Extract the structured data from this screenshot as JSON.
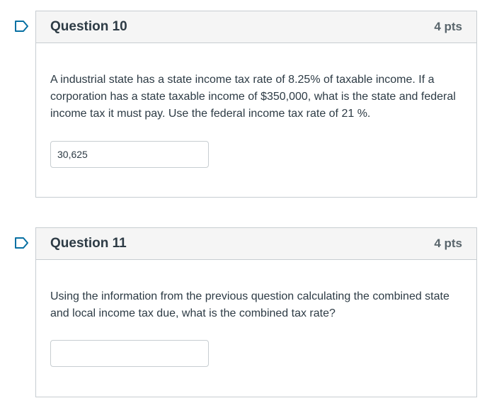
{
  "questions": [
    {
      "title": "Question 10",
      "points": "4 pts",
      "text": "A industrial state has a state income tax rate of 8.25% of taxable income. If a corporation has a state taxable income of $350,000, what is the state and federal income tax it must pay. Use the federal income tax rate of 21 %.",
      "answer_value": "30,625"
    },
    {
      "title": "Question 11",
      "points": "4 pts",
      "text": "Using the information from the previous question calculating the combined state and local income tax due, what is the combined tax rate?",
      "answer_value": ""
    }
  ],
  "colors": {
    "flag": "#0770a3",
    "border": "#c7cdd1",
    "header_bg": "#f5f5f5",
    "text": "#2d3b45"
  },
  "icons": [
    "flag-question-icon"
  ]
}
